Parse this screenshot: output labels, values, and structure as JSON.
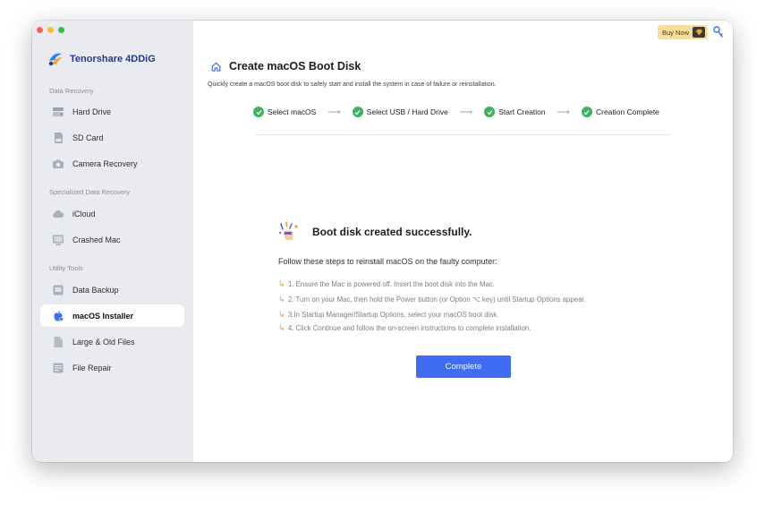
{
  "app": {
    "name": "Tenorshare 4DDiG"
  },
  "sidebar": {
    "sections": [
      {
        "label": "Data Recovery"
      },
      {
        "label": "Specialized Data Recovery"
      },
      {
        "label": "Utility Tools"
      }
    ],
    "items": [
      {
        "label": "Hard Drive",
        "icon": "hard-drive-icon"
      },
      {
        "label": "SD Card",
        "icon": "sd-card-icon"
      },
      {
        "label": "Camera Recovery",
        "icon": "camera-icon"
      },
      {
        "label": "iCloud",
        "icon": "cloud-icon"
      },
      {
        "label": "Crashed Mac",
        "icon": "crashed-mac-icon"
      },
      {
        "label": "Data Backup",
        "icon": "backup-icon"
      },
      {
        "label": "macOS Installer",
        "icon": "apple-icon",
        "active": true
      },
      {
        "label": "Large & Old Files",
        "icon": "file-icon"
      },
      {
        "label": "File Repair",
        "icon": "file-repair-icon"
      }
    ]
  },
  "header": {
    "buy_now": "Buy Now",
    "title": "Create macOS Boot Disk",
    "subtitle": "Quickly create a macOS boot disk to safely start and install the system in case of failure or reinstallation."
  },
  "steps": [
    {
      "label": "Select macOS"
    },
    {
      "label": "Select USB / Hard Drive"
    },
    {
      "label": "Start Creation"
    },
    {
      "label": "Creation Complete"
    }
  ],
  "result": {
    "title": "Boot disk created successfully.",
    "intro": "Follow these steps to reinstall macOS on the faulty computer:",
    "instructions": [
      "1. Ensure the Mac is powered off. Insert the boot disk into the Mac.",
      "2. Turn on your Mac, then hold the Power button (or Option ⌥ key) until Startup Options appear.",
      "3.In Startup Manager/Startup Options, select your macOS boot disk.",
      "4. Click Continue and follow the on-screen instructions to complete installation."
    ],
    "button": "Complete"
  },
  "colors": {
    "accent": "#3f6cf2",
    "success": "#3db35c",
    "sidebar_bg": "#e9ebf0",
    "buy_bg": "#f8dd9a"
  }
}
